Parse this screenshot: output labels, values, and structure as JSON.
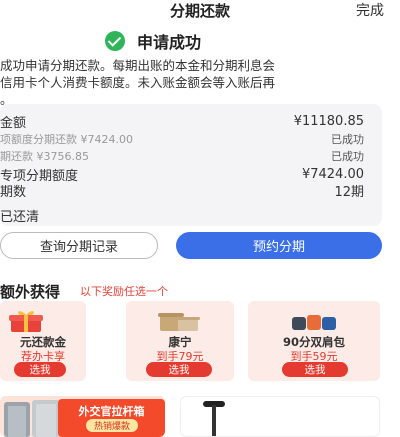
{
  "header": {
    "title": "分期还款",
    "done_label": "完成"
  },
  "status": {
    "label": "申请成功",
    "color": "#2fb45a"
  },
  "description": "成功申请分期还款。每期出账的本金和分期利息会\n信用卡个人消费卡额度。未入账金额会等入账后再\n。",
  "summary": {
    "total_label": "金额",
    "total_value": "¥11180.85",
    "item1_label": "项额度分期还款 ¥7424.00",
    "item1_status": "已成功",
    "item2_label": "期还款 ¥3756.85",
    "item2_status": "已成功",
    "quota_label": "专项分期额度",
    "quota_value": "¥7424.00",
    "periods_label": "期数",
    "periods_value": "12期",
    "paid_label": "已还清"
  },
  "buttons": {
    "query_label": "查询分期记录",
    "reserve_label": "预约分期",
    "primary_color": "#3b6fe8"
  },
  "extra": {
    "title": "额外获得",
    "subtitle": "以下奖励任选一个",
    "rewards": [
      {
        "name": "元还款金",
        "price": "荐办卡享",
        "pick": "选我"
      },
      {
        "name": "康宁",
        "price": "到手79元",
        "pick": "选我"
      },
      {
        "name": "90分双肩包",
        "price": "到手59元",
        "pick": "选我"
      }
    ]
  },
  "promo": {
    "title": "外交官拉杆箱",
    "tag": "热销爆款"
  },
  "accent_red": "#e43a2f"
}
